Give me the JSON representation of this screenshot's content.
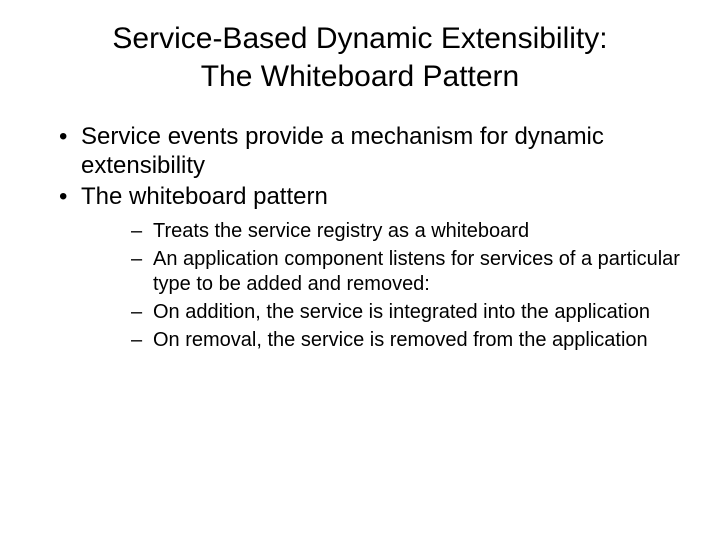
{
  "title_line1": "Service-Based Dynamic Extensibility:",
  "title_line2": "The Whiteboard Pattern",
  "bullets": {
    "b1": "Service events provide a mechanism for dynamic extensibility",
    "b2": "The whiteboard pattern"
  },
  "sub_bullets": {
    "s1": "Treats the service registry as a whiteboard",
    "s2": "An application component listens for services of a particular type to be added and removed:",
    "s3": "On addition, the service is integrated into the application",
    "s4": "On removal, the service is removed from the application"
  }
}
